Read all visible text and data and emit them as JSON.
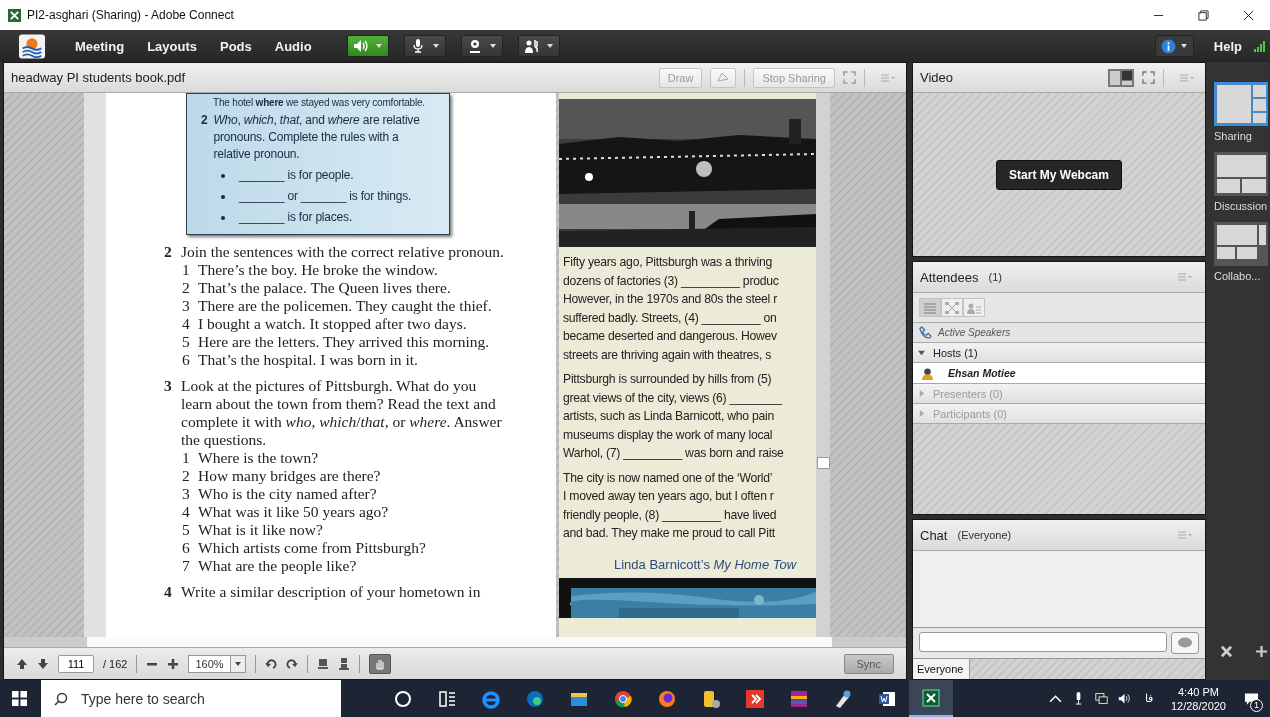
{
  "window": {
    "title": "PI2-asghari (Sharing) - Adobe Connect"
  },
  "menubar": {
    "menus": [
      "Meeting",
      "Layouts",
      "Pods",
      "Audio"
    ],
    "controls": [
      {
        "kind": "speaker",
        "on": true
      },
      {
        "kind": "microphone",
        "on": false
      },
      {
        "kind": "webcam",
        "on": false
      },
      {
        "kind": "raise-hand",
        "on": false
      }
    ],
    "help": "Help"
  },
  "share_pod": {
    "title": "headway PI students book.pdf",
    "buttons": [
      "Draw",
      "Stop Sharing"
    ]
  },
  "document": {
    "top_line": "The hotel **where** we stayed was very comfortable.",
    "rules": {
      "number": "2",
      "text": "*Who*, *which*, *that*, and *where* are relative pronouns. Complete the rules with a relative pronoun.",
      "bullets": [
        "_______ is for people.",
        "_______ or _______ is for things.",
        "_______ is for places."
      ]
    },
    "exercises": [
      {
        "number": "2",
        "text": "Join the sentences with the correct relative pronoun.",
        "items": [
          {
            "number": "1",
            "text": "There’s the boy. He broke the window."
          },
          {
            "number": "2",
            "text": "That’s the palace. The Queen lives there."
          },
          {
            "number": "3",
            "text": "There are the policemen. They caught the thief."
          },
          {
            "number": "4",
            "text": "I bought a watch. It stopped after two days."
          },
          {
            "number": "5",
            "text": "Here are the letters. They arrived this morning."
          },
          {
            "number": "6",
            "text": "That’s the hospital. I was born in it."
          }
        ]
      },
      {
        "number": "3",
        "text": "Look at the pictures of Pittsburgh. What do you learn about the town from them? Read the text and complete it with *who*, *which*/*that*, or *where*. Answer the questions.",
        "items": [
          {
            "number": "1",
            "text": "Where is the town?"
          },
          {
            "number": "2",
            "text": "How many bridges are there?"
          },
          {
            "number": "3",
            "text": "Who is the city named after?"
          },
          {
            "number": "4",
            "text": "What was it like 50 years ago?"
          },
          {
            "number": "5",
            "text": "What is it like now?"
          },
          {
            "number": "6",
            "text": "Which artists come from Pittsburgh?"
          },
          {
            "number": "7",
            "text": "What are the people like?"
          }
        ]
      },
      {
        "number": "4",
        "text": "Write a similar description of your hometown in"
      }
    ],
    "reading": {
      "paragraphs": [
        [
          "Fifty years ago, Pittsburgh was a thriving",
          "dozens of factories (3) _________ produc",
          "However, in the 1970s and 80s the steel r",
          "suffered badly. Streets, (4) _________ on",
          "became deserted and dangerous. Howev",
          "streets are thriving again with theatres, s"
        ],
        [
          "Pittsburgh is surrounded by hills from (5)",
          "great views of the city, views (6) ________",
          "artists, such as Linda Barnicott, who pain",
          "museums display the work of many local",
          "Warhol, (7) _________ was born and raise"
        ],
        [
          "The city is now named one of the ‘World’",
          "I moved away ten years ago, but I often r",
          "friendly people, (8) _________ have lived",
          "and bad. They make me proud to call Pitt"
        ]
      ],
      "caption": "Linda Barnicott’s *My Home Tow*"
    }
  },
  "page_toolbar": {
    "page": "111",
    "total": "/ 162",
    "zoom": "160%",
    "sync": "Sync"
  },
  "video_pod": {
    "title": "Video",
    "button": "Start My Webcam"
  },
  "attendees_pod": {
    "title": "Attendees",
    "count": "(1)",
    "views": [
      {
        "selected": true
      },
      {
        "selected": false
      },
      {
        "selected": false
      }
    ],
    "active_speakers": "Active Speakers",
    "groups": [
      {
        "label": "Hosts (1)",
        "expanded": true,
        "children": [
          {
            "name": "Ehsan Motiee"
          }
        ]
      },
      {
        "label": "Presenters (0)",
        "expanded": false
      },
      {
        "label": "Participants (0)",
        "expanded": false
      }
    ]
  },
  "chat_pod": {
    "title": "Chat",
    "scope": "(Everyone)",
    "tabs": [
      {
        "label": "Everyone",
        "selected": true
      }
    ]
  },
  "layouts": [
    {
      "label": "Sharing",
      "selected": true
    },
    {
      "label": "Discussion",
      "selected": false
    },
    {
      "label": "Collabo...",
      "selected": false
    }
  ],
  "taskbar": {
    "search_placeholder": "Type here to search",
    "apps": [
      {
        "kind": "cortana",
        "selected": false
      },
      {
        "kind": "taskview",
        "selected": false
      },
      {
        "kind": "ie",
        "selected": false
      },
      {
        "kind": "edge",
        "selected": false
      },
      {
        "kind": "explorer",
        "selected": false
      },
      {
        "kind": "chrome",
        "selected": false
      },
      {
        "kind": "firefox",
        "selected": false
      },
      {
        "kind": "tool",
        "selected": false
      },
      {
        "kind": "remote",
        "selected": false
      },
      {
        "kind": "archive",
        "selected": false
      },
      {
        "kind": "paint",
        "selected": false
      },
      {
        "kind": "word",
        "selected": false
      },
      {
        "kind": "connect",
        "selected": true
      }
    ],
    "language": "فا",
    "time": "4:40 PM",
    "date": "12/28/2020",
    "notifications": "1"
  }
}
